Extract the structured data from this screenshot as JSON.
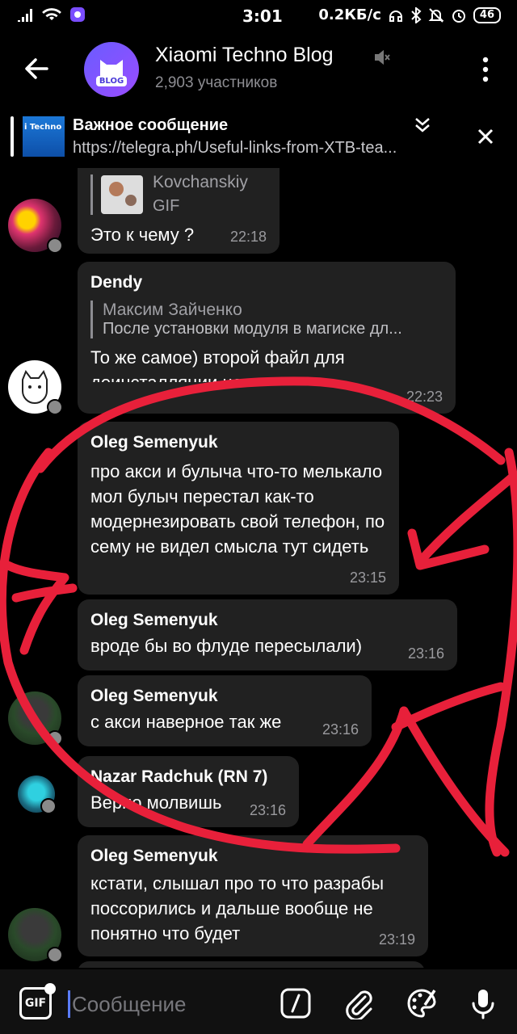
{
  "status": {
    "time": "3:01",
    "net_speed": "0.2КБ/с",
    "battery": "46"
  },
  "header": {
    "title": "Xiaomi Techno Blog",
    "subtitle": "2,903 участников",
    "avatar_tag": "BLOG"
  },
  "pinned": {
    "title": "Важное сообщение",
    "text": "https://telegra.ph/Useful-links-from-XTB-tea...",
    "thumb_text": "i Techno"
  },
  "messages": [
    {
      "reply_name": "Kovchanskiy",
      "reply_text": "GIF",
      "text": "Это к чему ?",
      "time": "22:18"
    },
    {
      "sender": "Dendy",
      "reply_name": "Максим Зайченко",
      "reply_text": "После установки модуля в магиске дл...",
      "text": "То же самое) второй файл для деинсталляции не помогает",
      "time": "22:23"
    },
    {
      "sender": "Oleg Semenyuk",
      "text": "про акси и булыча что-то мелькало мол булыч перестал как-то модернезировать свой телефон, по сему не видел смысла тут сидеть",
      "time": "23:15"
    },
    {
      "sender": "Oleg Semenyuk",
      "text": "вроде бы во флуде пересылали)",
      "time": "23:16"
    },
    {
      "sender": "Oleg Semenyuk",
      "text": "с акси наверное так же",
      "time": "23:16"
    },
    {
      "sender": "Nazar Radchuk (RN 7)",
      "text": "Верно молвишь",
      "time": "23:16"
    },
    {
      "sender": "Oleg Semenyuk",
      "text": "кстати, слышал про то что разрабы поссорились и дальше вообще не понятно что будет",
      "time": "23:19"
    }
  ],
  "input": {
    "placeholder": "Сообщение",
    "gif_label": "GIF"
  },
  "colors": {
    "bubble": "#212121",
    "annotation": "#e8203a",
    "accent": "#5a7cff"
  },
  "icons": [
    "back-icon",
    "mute-icon",
    "menu-icon",
    "expand-icon",
    "close-icon",
    "gif-icon",
    "command-icon",
    "attach-icon",
    "brush-icon",
    "mic-icon"
  ]
}
